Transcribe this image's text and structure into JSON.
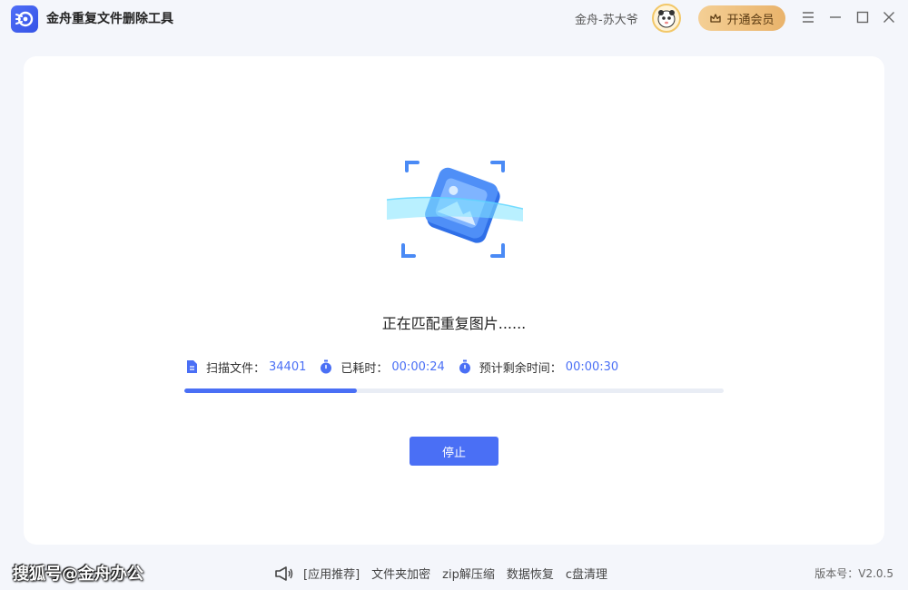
{
  "app": {
    "title": "金舟重复文件删除工具",
    "user_name": "金舟-苏大爷",
    "vip_label": "开通会员"
  },
  "main": {
    "status_text": "正在匹配重复图片......",
    "stats": {
      "scan_label": "扫描文件：",
      "scan_value": "34401",
      "elapsed_label": "已耗时：",
      "elapsed_value": "00:00:24",
      "remaining_label": "预计剩余时间：",
      "remaining_value": "00:00:30"
    },
    "progress_fraction": 0.32,
    "stop_label": "停止"
  },
  "footer": {
    "watermark": "搜狐号@金舟办公",
    "recommend_label": "[应用推荐]",
    "links": [
      "文件夹加密",
      "zip解压缩",
      "数据恢复",
      "c盘清理"
    ],
    "version": "版本号：V2.0.5"
  },
  "colors": {
    "accent": "#4a6ff5",
    "vip_gold": "#e9b36b",
    "background": "#f4f6fb"
  },
  "icons": [
    "app-logo-icon",
    "avatar-icon",
    "crown-icon",
    "menu-icon",
    "minimize-icon",
    "maximize-icon",
    "close-icon",
    "file-icon",
    "timer-icon",
    "megaphone-icon"
  ]
}
